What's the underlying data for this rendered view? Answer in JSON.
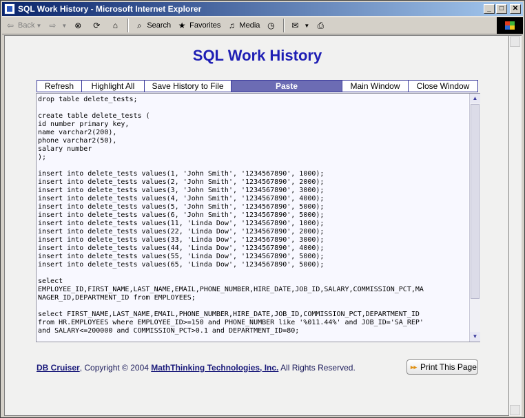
{
  "window": {
    "title": "SQL Work History - Microsoft Internet Explorer",
    "minimize_icon": "minimize-icon",
    "maximize_icon": "maximize-icon",
    "close_icon": "close-icon"
  },
  "toolbar": {
    "back_label": "Back",
    "search_label": "Search",
    "favorites_label": "Favorites",
    "media_label": "Media"
  },
  "page": {
    "title": "SQL Work History",
    "title_color": "#1e1eb4"
  },
  "buttons": {
    "refresh": "Refresh",
    "highlight_all": "Highlight All",
    "save_history": "Save History to File",
    "paste": "Paste",
    "main_window": "Main Window",
    "close_window": "Close Window",
    "active_color": "#6c6cb4"
  },
  "editor": {
    "content": "drop table delete_tests;\n\ncreate table delete_tests (\nid number primary key,\nname varchar2(200),\nphone varchar2(50),\nsalary number\n);\n\ninsert into delete_tests values(1, 'John Smith', '1234567890', 1000);\ninsert into delete_tests values(2, 'John Smith', '1234567890', 2000);\ninsert into delete_tests values(3, 'John Smith', '1234567890', 3000);\ninsert into delete_tests values(4, 'John Smith', '1234567890', 4000);\ninsert into delete_tests values(5, 'John Smith', '1234567890', 5000);\ninsert into delete_tests values(6, 'John Smith', '1234567890', 5000);\ninsert into delete_tests values(11, 'Linda Dow', '1234567890', 1000);\ninsert into delete_tests values(22, 'Linda Dow', '1234567890', 2000);\ninsert into delete_tests values(33, 'Linda Dow', '1234567890', 3000);\ninsert into delete_tests values(44, 'Linda Dow', '1234567890', 4000);\ninsert into delete_tests values(55, 'Linda Dow', '1234567890', 5000);\ninsert into delete_tests values(65, 'Linda Dow', '1234567890', 5000);\n\nselect\nEMPLOYEE_ID,FIRST_NAME,LAST_NAME,EMAIL,PHONE_NUMBER,HIRE_DATE,JOB_ID,SALARY,COMMISSION_PCT,MA\nNAGER_ID,DEPARTMENT_ID from EMPLOYEES;\n\nselect FIRST_NAME,LAST_NAME,EMAIL,PHONE_NUMBER,HIRE_DATE,JOB_ID,COMMISSION_PCT,DEPARTMENT_ID\nfrom HR.EMPLOYEES where EMPLOYEE_ID>=150 and PHONE_NUMBER like '%011.44%' and JOB_ID='SA_REP'\nand SALARY<=200000 and COMMISSION_PCT>0.1 and DEPARTMENT_ID=80;"
  },
  "footer": {
    "product_link": "DB Cruiser",
    "copyright_prefix": ",  Copyright © 2004 ",
    "company_link": "MathThinking Technologies, Inc.",
    "rights": "  All Rights Reserved.",
    "print_button": "Print This Page"
  }
}
